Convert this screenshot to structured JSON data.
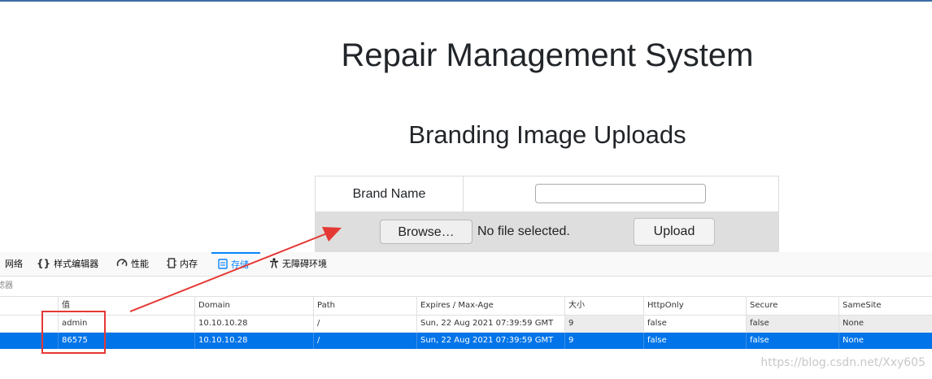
{
  "page": {
    "title": "Repair Management System",
    "subtitle": "Branding Image Uploads"
  },
  "form": {
    "brand_label": "Brand Name",
    "brand_value": "",
    "browse_label": "Browse…",
    "no_file_text": "No file selected.",
    "upload_label": "Upload"
  },
  "devtools": {
    "tabs": [
      {
        "label": "网络",
        "icon": "network-icon"
      },
      {
        "label": "样式编辑器",
        "icon": "braces-icon"
      },
      {
        "label": "性能",
        "icon": "gauge-icon"
      },
      {
        "label": "内存",
        "icon": "memory-icon"
      },
      {
        "label": "存储",
        "icon": "storage-icon",
        "active": true
      },
      {
        "label": "无障碍环境",
        "icon": "accessibility-icon"
      }
    ],
    "filter_label": "滤器",
    "columns": [
      "值",
      "Domain",
      "Path",
      "Expires / Max-Age",
      "大小",
      "HttpOnly",
      "Secure",
      "SameSite"
    ],
    "rows": [
      {
        "value": "admin",
        "domain": "10.10.10.28",
        "path": "/",
        "expires": "Sun, 22 Aug 2021 07:39:59 GMT",
        "size": "9",
        "httponly": "false",
        "secure": "false",
        "samesite": "None"
      },
      {
        "value": "86575",
        "domain": "10.10.10.28",
        "path": "/",
        "expires": "Sun, 22 Aug 2021 07:39:59 GMT",
        "size": "9",
        "httponly": "false",
        "secure": "false",
        "samesite": "None",
        "selected": true
      }
    ]
  },
  "watermark": "https://blog.csdn.net/Xxy605",
  "colors": {
    "accent": "#0a84ff",
    "selected_row": "#0074e8",
    "annotation": "#e53935"
  }
}
